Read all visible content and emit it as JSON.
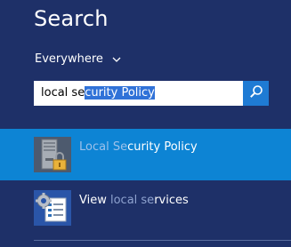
{
  "search": {
    "title": "Search",
    "scope_label": "Everywhere",
    "query_before": "local se",
    "query_selected": "curity Policy",
    "search_icon": "magnifier-icon"
  },
  "results": [
    {
      "label_dim_1": "Local Se",
      "label_bold": "curity Policy",
      "label_dim_2": "",
      "icon": "local-security-policy-icon",
      "selected": true
    },
    {
      "label_1": "View ",
      "label_dim": "local se",
      "label_2": "rvices",
      "icon": "services-icon",
      "selected": false
    }
  ],
  "colors": {
    "background": "#1e3068",
    "selected_row": "#0d84d4",
    "search_button": "#1f7bd4",
    "text_selection": "#3072d8"
  }
}
